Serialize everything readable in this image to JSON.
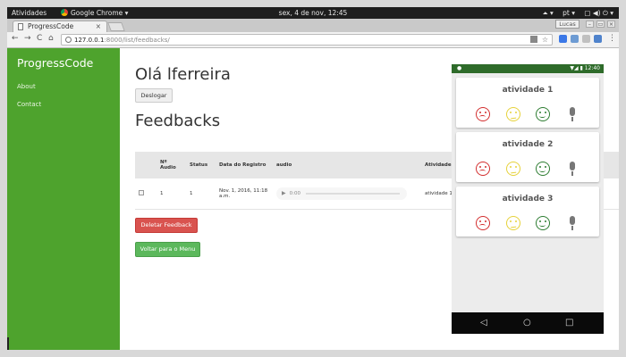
{
  "os_bar": {
    "activities": "Atividades",
    "app": "Google Chrome ▾",
    "clock": "sex,  4 de nov, 12:45",
    "lang": "pt ▾",
    "net": "⏶ ▾",
    "tray": "▢ ◀) ⏻ ▾"
  },
  "browser": {
    "tab_title": "ProgressCode",
    "tab_close": "×",
    "user_button": "Lucas",
    "win_min": "–",
    "win_max": "▭",
    "win_close": "×",
    "back": "←",
    "forward": "→",
    "reload": "C",
    "home": "⌂",
    "url_host": "127.0.0.1",
    "url_port": ":8000",
    "url_path": "/list/feedbacks/",
    "star": "☆",
    "menu": "⋮"
  },
  "sidebar": {
    "brand": "ProgressCode",
    "links": [
      "About",
      "Contact"
    ]
  },
  "main": {
    "greeting": "Olá lferreira",
    "logout_label": "Deslogar",
    "heading": "Feedbacks",
    "table": {
      "headers": [
        "",
        "Nº Audio",
        "Status",
        "Data do Registro",
        "audio",
        "Atividade"
      ],
      "rows": [
        {
          "num": "1",
          "status": "1",
          "date": "Nov. 1, 2016, 11:18 a.m.",
          "audio_time": "0:00",
          "activity": "atividade 1"
        }
      ]
    },
    "delete_label": "Deletar Feedback",
    "back_label": "Voltar para o Menu"
  },
  "phone": {
    "status_time": "12:40",
    "status_icons": "▼◢ ▮",
    "status_left": "●",
    "cards": [
      {
        "title": "atividade 1"
      },
      {
        "title": "atividade 2"
      },
      {
        "title": "atividade 3"
      }
    ],
    "nav_back": "◁",
    "nav_home": "○",
    "nav_recent": "□"
  },
  "colors": {
    "sidebar": "#4ea32d",
    "danger": "#d9534f",
    "success": "#5cb85c",
    "phone_status": "#2e6b2a"
  }
}
